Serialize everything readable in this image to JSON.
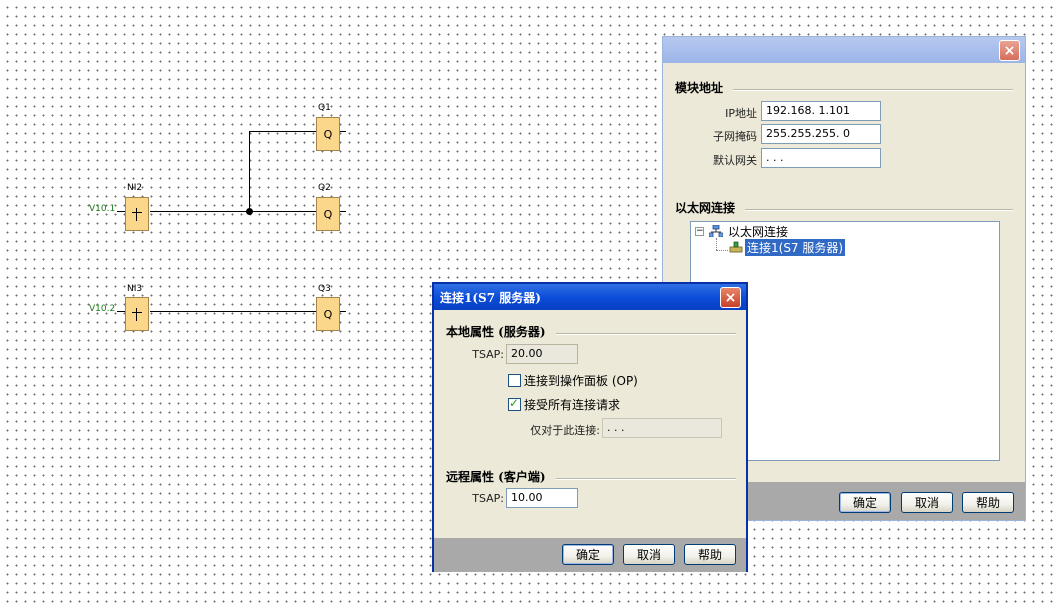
{
  "diagram": {
    "blocks": [
      {
        "id": "NI2",
        "label": "NI2",
        "var": "V10.1"
      },
      {
        "id": "NI3",
        "label": "NI3",
        "var": "V10.2"
      },
      {
        "id": "Q1",
        "label": "Q1",
        "text": "Q"
      },
      {
        "id": "Q2",
        "label": "Q2",
        "text": "Q"
      },
      {
        "id": "Q3",
        "label": "Q3",
        "text": "Q"
      }
    ]
  },
  "module_window": {
    "close_icon": "×",
    "address_group": {
      "title": "模块地址",
      "ip_label": "IP地址",
      "ip_value": "192.168. 1.101",
      "subnet_label": "子网掩码",
      "subnet_value": "255.255.255. 0",
      "gateway_label": "默认网关",
      "gateway_value": " .  .  ."
    },
    "ethernet_group": {
      "title": "以太网连接",
      "tree_root": "以太网连接",
      "tree_child": "连接1(S7 服务器)"
    },
    "buttons": {
      "ok": "确定",
      "cancel": "取消",
      "help": "帮助"
    }
  },
  "connection_dialog": {
    "title": "连接1(S7 服务器)",
    "close_icon": "×",
    "local_group": {
      "title": "本地属性 (服务器)",
      "tsap_label": "TSAP:",
      "tsap_value": "20.00",
      "op_checkbox_label": "连接到操作面板 (OP)",
      "op_checked": false,
      "accept_all_label": "接受所有连接请求",
      "accept_all_checked": true,
      "only_for_label": "仅对于此连接:",
      "only_for_value": " .  .  ."
    },
    "remote_group": {
      "title": "远程属性 (客户端)",
      "tsap_label": "TSAP:",
      "tsap_value": "10.00"
    },
    "buttons": {
      "ok": "确定",
      "cancel": "取消",
      "help": "帮助"
    }
  }
}
